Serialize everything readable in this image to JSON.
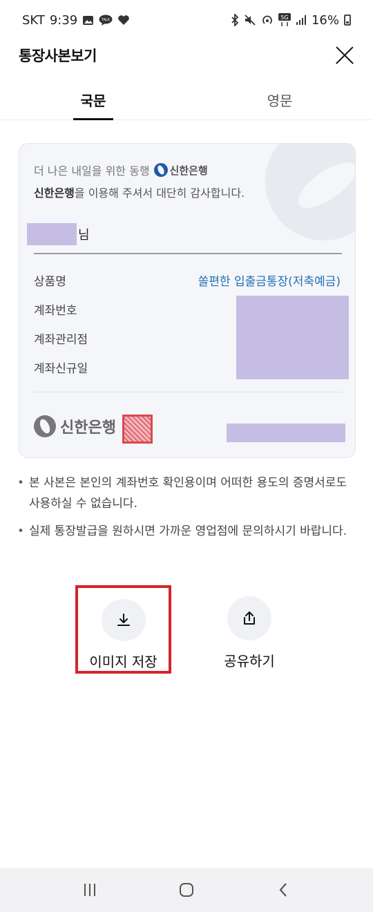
{
  "status_bar": {
    "carrier": "SKT",
    "time": "9:39",
    "battery": "16%",
    "network": "5G"
  },
  "header": {
    "title": "통장사본보기"
  },
  "tabs": [
    {
      "label": "국문",
      "active": true
    },
    {
      "label": "영문",
      "active": false
    }
  ],
  "card": {
    "slogan": "더 나은 내일을 위한 동행",
    "slogan_logo": "신한은행",
    "thanks_bank": "신한은행",
    "thanks_text": "을 이용해 주셔서 대단히 감사합니다.",
    "name_suffix": "님",
    "rows": [
      {
        "label": "상품명"
      },
      {
        "label": "계좌번호"
      },
      {
        "label": "계좌관리점"
      },
      {
        "label": "계좌신규일"
      }
    ],
    "product_value": "쏠편한 입출금통장(저축예금)",
    "bank_logo": "신한은행"
  },
  "notes": [
    "본 사본은 본인의 계좌번호 확인용이며 어떠한 용도의 증명서로도 사용하실 수 없습니다.",
    "실제 통장발급을 원하시면 가까운 영업점에 문의하시기 바랍니다."
  ],
  "actions": {
    "save_label": "이미지 저장",
    "share_label": "공유하기"
  },
  "colors": {
    "accent_blue": "#1f6fb3",
    "highlight_red": "#d4242b",
    "redaction": "#c6bde4"
  }
}
